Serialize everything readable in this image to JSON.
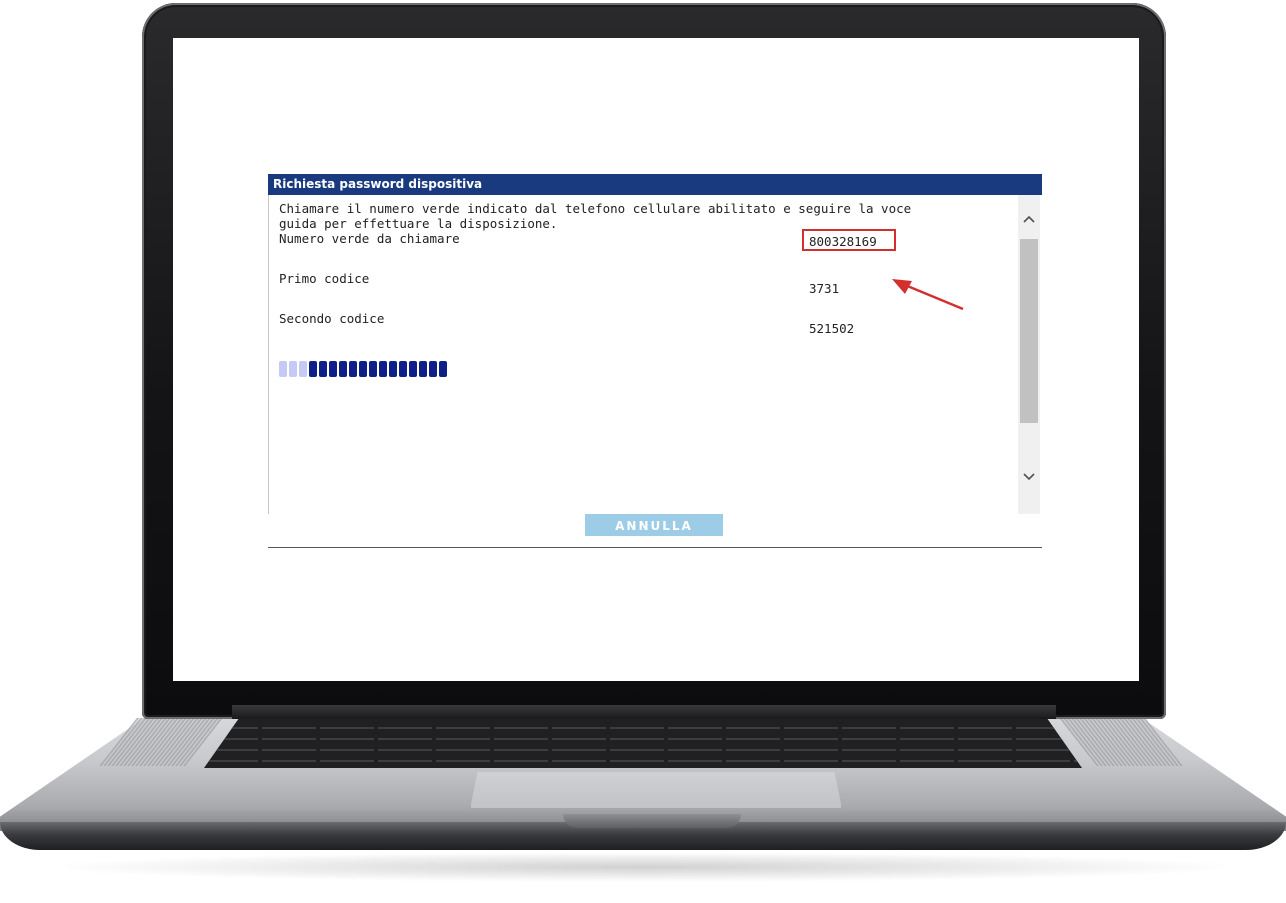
{
  "dialog": {
    "title": "Richiesta password dispositiva",
    "intro_line1": "Chiamare il numero verde indicato dal telefono cellulare abilitato e seguire la voce",
    "intro_line2": "guida per effettuare la disposizione.",
    "rows": [
      {
        "label": "Numero verde da chiamare",
        "value": "800328169"
      },
      {
        "label": "Primo codice",
        "value": "3731"
      },
      {
        "label": "Secondo codice",
        "value": "521502"
      }
    ],
    "progress": {
      "total_segments": 17,
      "completed_segments": 3,
      "light_color": "#c5caf5",
      "dark_color": "#0f1f8a"
    },
    "cancel_label": "ANNULLA"
  },
  "colors": {
    "title_bar": "#1a3a7f",
    "button": "#9ccce6",
    "highlight": "#d32f2f",
    "arrow": "#d32f2f"
  },
  "icons": {
    "scroll_up": "chevron-up-icon",
    "scroll_down": "chevron-down-icon",
    "annotation": "arrow-icon"
  }
}
